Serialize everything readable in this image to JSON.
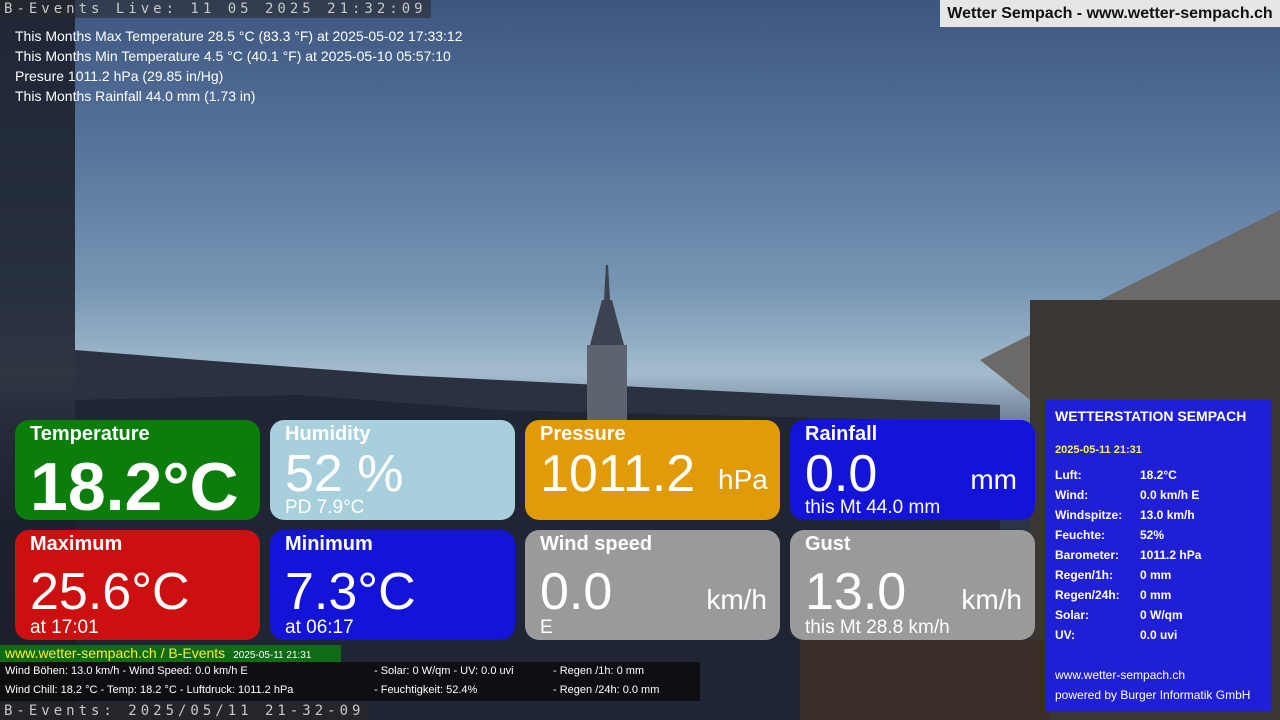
{
  "header": {
    "live_stamp": "B-Events Live: 11 05 2025 21:32:09",
    "site_badge": "Wetter Sempach - www.wetter-sempach.ch"
  },
  "stats": [
    "This Months Max Temperature 28.5 °C (83.3 °F) at 2025-05-02 17:33:12",
    "This Months Min Temperature 4.5 °C (40.1 °F) at 2025-05-10 05:57:10",
    "Presure 1011.2 hPa (29.85 in/Hg)",
    "This Months Rainfall 44.0 mm (1.73 in)"
  ],
  "tiles": {
    "temperature": {
      "title": "Temperature",
      "value": "18.2°C",
      "color": "#0a7d0a"
    },
    "humidity": {
      "title": "Humidity",
      "value": "52 %",
      "sub": "PD 7.9°C",
      "color": "#a8d0dc"
    },
    "pressure": {
      "title": "Pressure",
      "value": "1011.2",
      "unit": "hPa",
      "color": "#e19a08"
    },
    "rainfall": {
      "title": "Rainfall",
      "value": "0.0",
      "unit": "mm",
      "sub": "this Mt 44.0 mm",
      "color": "#1414d8"
    },
    "maximum": {
      "title": "Maximum",
      "value": "25.6°C",
      "sub": "at 17:01",
      "color": "#cc1010"
    },
    "minimum": {
      "title": "Minimum",
      "value": "7.3°C",
      "sub": "at 06:17",
      "color": "#1414d8"
    },
    "windspeed": {
      "title": "Wind speed",
      "value": "0.0",
      "unit": "km/h",
      "sub": "E",
      "color": "#9a9a9a"
    },
    "gust": {
      "title": "Gust",
      "value": "13.0",
      "unit": "km/h",
      "sub": "this Mt 28.8 km/h",
      "color": "#9a9a9a"
    }
  },
  "panel": {
    "title": "WETTERSTATION SEMPACH",
    "datetime": "2025-05-11 21:31",
    "rows": [
      {
        "k": "Luft:",
        "v": "18.2°C"
      },
      {
        "k": "Wind:",
        "v": "0.0 km/h  E"
      },
      {
        "k": "Windspitze:",
        "v": "13.0 km/h"
      },
      {
        "k": "Feuchte:",
        "v": "52%"
      },
      {
        "k": "Barometer:",
        "v": "1011.2 hPa"
      },
      {
        "k": "Regen/1h:",
        "v": "0 mm"
      },
      {
        "k": "Regen/24h:",
        "v": "0 mm"
      },
      {
        "k": "Solar:",
        "v": "0 W/qm"
      },
      {
        "k": "UV:",
        "v": "0.0 uvi"
      }
    ],
    "website": "www.wetter-sempach.ch",
    "powered": "powered by Burger Informatik GmbH"
  },
  "footer": {
    "website": "www.wetter-sempach.ch / B-Events",
    "datetime": "2025-05-11 21:31",
    "line1": {
      "a": "Wind Böhen: 13.0 km/h  - Wind Speed: 0.0 km/h E",
      "b": "- Solar: 0 W/qm   - UV: 0.0 uvi",
      "c": "- Regen /1h:   0 mm"
    },
    "line2": {
      "a": "Wind Chill: 18.2 °C        - Temp: 18.2 °C  - Luftdruck: 1011.2 hPa",
      "b": "- Feuchtigkeit: 52.4%",
      "c": "- Regen /24h: 0.0 mm"
    },
    "stamp": "B-Events: 2025/05/11 21-32-09"
  }
}
